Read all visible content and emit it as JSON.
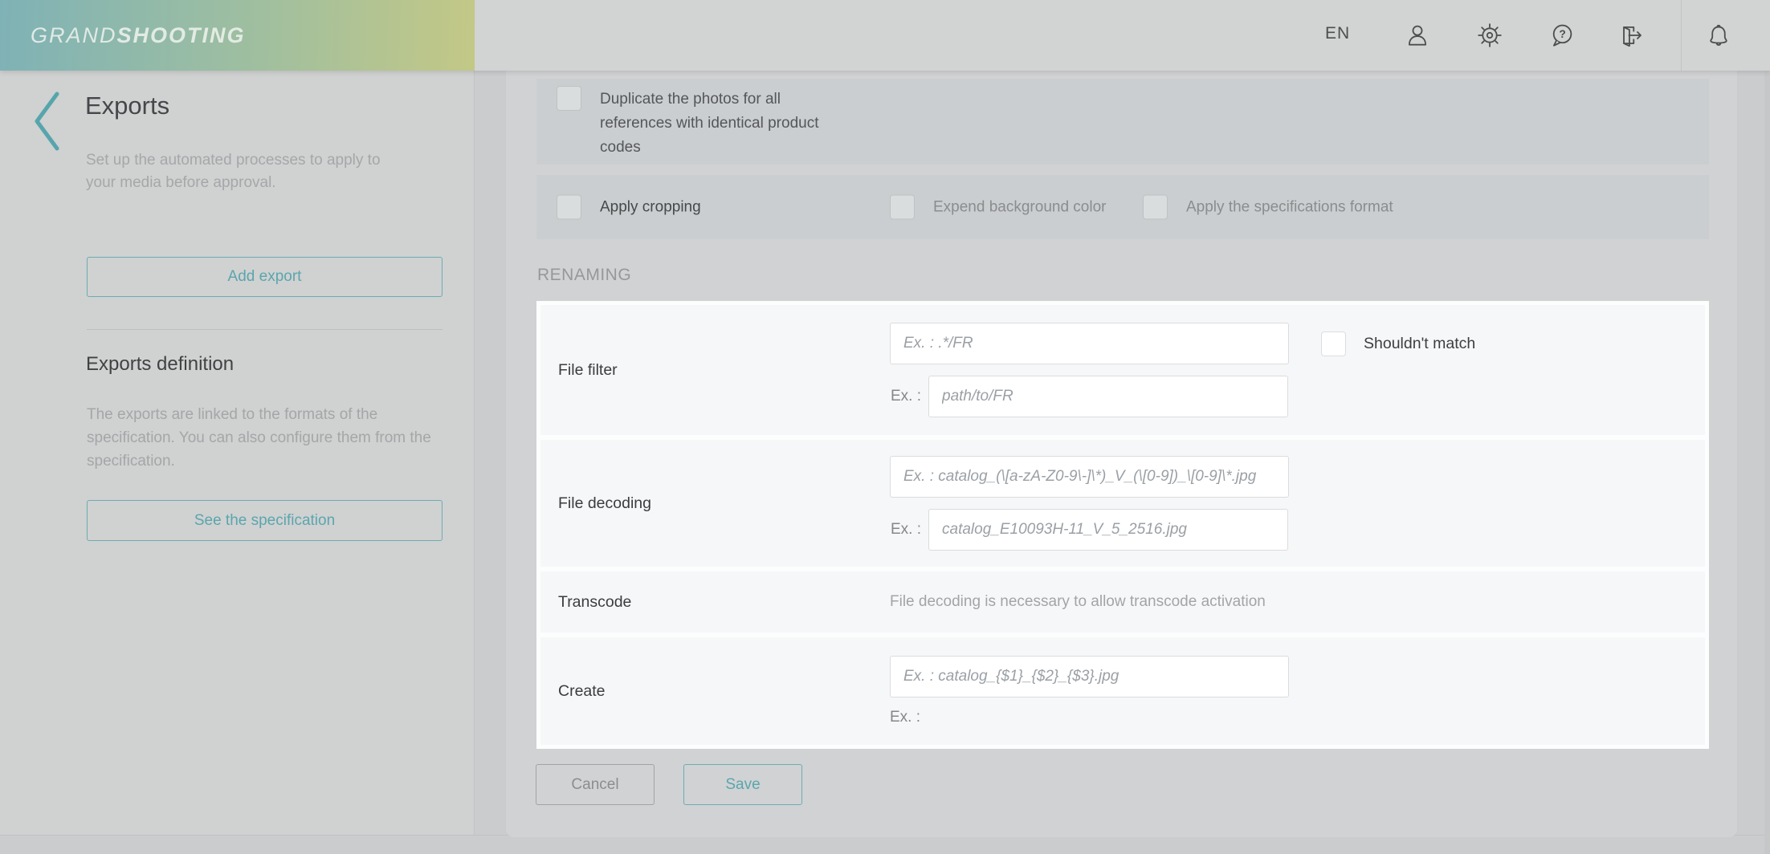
{
  "header": {
    "brand": {
      "light": "GRAND",
      "bold": "SHOOTING"
    },
    "language": "EN",
    "icons": {
      "user": "user-icon",
      "settings": "settings-gear-icon",
      "help": "help-icon",
      "help_glyph": "?",
      "logout": "logout-icon",
      "bell": "notifications-bell-icon"
    }
  },
  "sidebar": {
    "back_icon": "chevron-left-icon",
    "title": "Exports",
    "description": "Set up the automated processes to apply to your media before approval.",
    "add_button_label": "Add export",
    "definition": {
      "title": "Exports definition",
      "description": "The exports are linked to the formats of the specification. You can also configure them from the specification.",
      "button_label": "See the specification"
    }
  },
  "main": {
    "options": {
      "duplicate_label": "Duplicate the photos for all references with identical product codes",
      "duplicate_checked": false,
      "apply_cropping_label": "Apply cropping",
      "apply_cropping_checked": false,
      "expend_background_label": "Expend background color",
      "expend_background_checked": false,
      "apply_specs_label": "Apply the specifications format",
      "apply_specs_checked": false
    },
    "renaming": {
      "section_title": "RENAMING",
      "file_filter": {
        "label": "File filter",
        "pattern_value": "",
        "pattern_placeholder": "Ex. : .*/FR",
        "shouldnt_match_label": "Shouldn't match",
        "shouldnt_match_checked": false,
        "example_label": "Ex. :",
        "example_value": "",
        "example_placeholder": "path/to/FR"
      },
      "file_decoding": {
        "label": "File decoding",
        "pattern_value": "",
        "pattern_placeholder": "Ex. : catalog_(\\[a-zA-Z0-9\\-]\\*)_V_(\\[0-9])_\\[0-9]\\*.jpg",
        "example_label": "Ex. :",
        "example_value": "",
        "example_placeholder": "catalog_E10093H-11_V_5_2516.jpg"
      },
      "transcode": {
        "label": "Transcode",
        "note": "File decoding is necessary to allow transcode activation"
      },
      "create": {
        "label": "Create",
        "pattern_value": "",
        "pattern_placeholder": "Ex. : catalog_{$1}_{$2}_{$3}.jpg",
        "example_label": "Ex. :"
      }
    },
    "actions": {
      "cancel_label": "Cancel",
      "save_label": "Save"
    }
  },
  "colors": {
    "accent_teal": "#5aa6ad",
    "header_gray": "#d2d3d3",
    "logo_gradient_start": "#7fb2b6",
    "logo_gradient_end": "#c3c886",
    "panel_white": "#fcfdfd",
    "row_tint": "#f6f7f8",
    "page_gray": "#cbccce"
  }
}
